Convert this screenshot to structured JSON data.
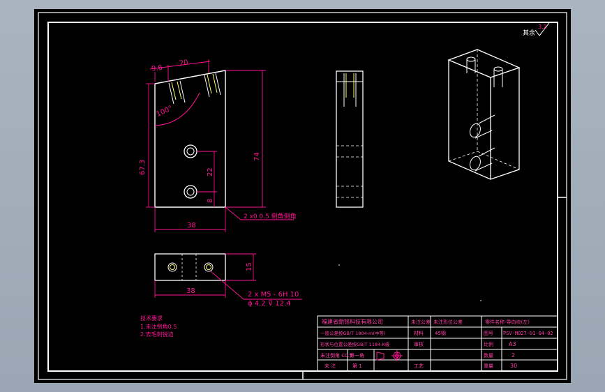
{
  "colors": {
    "background": "#000000",
    "frame": "#ffffff",
    "dimension": "#ff1493",
    "title_text": "#ff3ea5",
    "hole_thread": "#ffff66",
    "page": "#a2adb9"
  },
  "surface_finish": {
    "symbol_label": "其余",
    "value": "3.2"
  },
  "front_view": {
    "dims": {
      "top_left": "9.6",
      "top_width": "20",
      "angle": "100°",
      "height_left": "67.3",
      "height_right": "74",
      "hole_spacing": "22",
      "hole_bottom": "8",
      "width": "38"
    },
    "chamfer_note": {
      "prefix": "2 x",
      "spec": "0.5 倒角",
      "full": "2 x0 0.5 倒角倒角"
    }
  },
  "bottom_view": {
    "dims": {
      "width": "38",
      "depth": "15"
    },
    "hole_note_line1": "2 x  M5 - 6H 10",
    "hole_note_line2": "ϕ 4.2 ⊽ 12.4"
  },
  "tech_requirements": {
    "heading": "技术要求",
    "items": [
      "1.未注倒角0.5",
      "2.去毛刺锐边"
    ]
  },
  "title_block": {
    "rows": [
      [
        "福建省朗铭科技有限公司",
        "未注公差",
        "未注形位公差",
        "零件名称-导向块(左)"
      ],
      [
        "一般公差按GB/T 1804-m(中等)",
        "材料",
        "45钢",
        "图号",
        "PSV-M027-01-04-02"
      ],
      [
        "形状与位置公差按GB/T 1184-K级",
        "审核",
        "",
        "比例",
        "A3"
      ],
      [
        "未注倒角 C0.5",
        "第一角",
        "",
        "",
        "数量",
        "2"
      ],
      [
        "未 注",
        "第 1",
        "工艺",
        "",
        "重量",
        "30"
      ]
    ],
    "cells": {
      "company": "福建省朗铭科技有限公司",
      "general_tol": "一般公差按GB/T 1804-m(中等)",
      "geo_tol": "形状与位置公差按GB/T 1184-K级",
      "chamfer": "未注倒角 C0.5",
      "sheet_a": "未 注",
      "sheet_b": "第 1",
      "projection": "第一角",
      "h_tol": "未注公差",
      "h_tol_val": "未注形位公差",
      "h_material": "材料",
      "h_material_val": "45钢",
      "h_review": "审核",
      "h_process": "工艺",
      "part_name": "零件名称-导向块(左)",
      "h_drawing_no": "图号",
      "drawing_no": "PSV-M027-01-04-02",
      "h_scale": "比例",
      "scale": "A3",
      "h_qty": "数量",
      "qty": "2",
      "h_weight": "重量",
      "weight": "30"
    }
  }
}
